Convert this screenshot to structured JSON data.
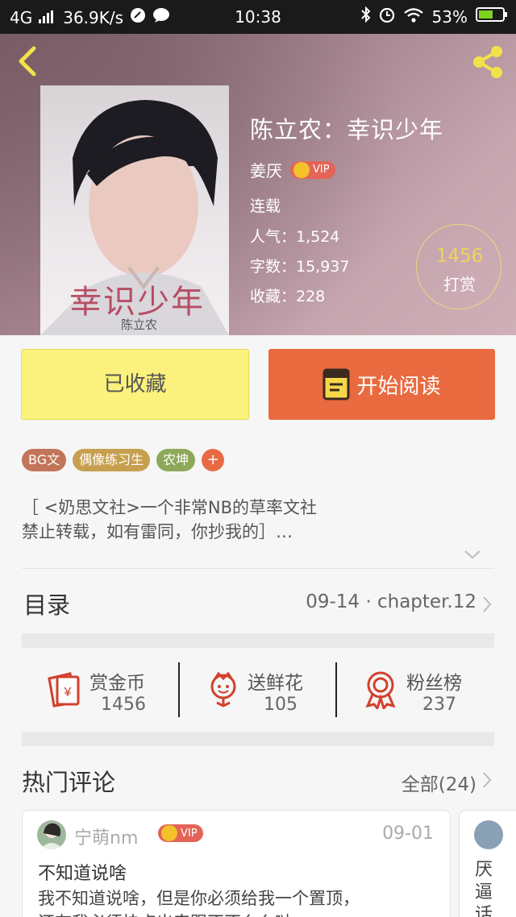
{
  "status_bar": {
    "network": "4G",
    "speed": "36.9K/s",
    "time": "10:38",
    "battery": "53%"
  },
  "book": {
    "title": "陈立农：幸识少年",
    "author": "姜厌",
    "vip_badge": "VIP",
    "status": "连载",
    "popularity": "人气：1,524",
    "word_count": "字数：15,937",
    "favorites": "收藏：228",
    "cover_title": "幸识少年",
    "cover_author": "陈立农"
  },
  "reward_circle": {
    "count": "1456",
    "label": "打赏"
  },
  "actions": {
    "collect_label": "已收藏",
    "read_label": "开始阅读"
  },
  "tags": [
    "BG文",
    "偶像练习生",
    "农坤",
    "+"
  ],
  "description": {
    "line1": "［ <奶思文社>一个非常NB的草率文社",
    "line2": "禁止转载，如有雷同，你抄我的］…"
  },
  "toc": {
    "label": "目录",
    "latest": "09-14 · chapter.12"
  },
  "stats": [
    {
      "label": "赏金币",
      "value": "1456",
      "icon": "coin-envelope-icon"
    },
    {
      "label": "送鲜花",
      "value": "105",
      "icon": "flower-icon"
    },
    {
      "label": "粉丝榜",
      "value": "237",
      "icon": "medal-icon"
    }
  ],
  "comments_section": {
    "title": "热门评论",
    "all_label": "全部(24)"
  },
  "comments": [
    {
      "user": "宁萌nm",
      "vip": "VIP",
      "date": "09-01",
      "title": "不知道说啥",
      "body_line1": "我不知道说啥，但是你必须给我一个置顶，",
      "body_line2": "还有我必须快点出来跟不不么么哒"
    },
    {
      "peek_text": "厌逼话"
    }
  ],
  "colors": {
    "collect_bg": "#fbf17d",
    "read_bg": "#e96a3f",
    "vip_bg": "#e46457",
    "reward_gold": "#f2d25a"
  }
}
